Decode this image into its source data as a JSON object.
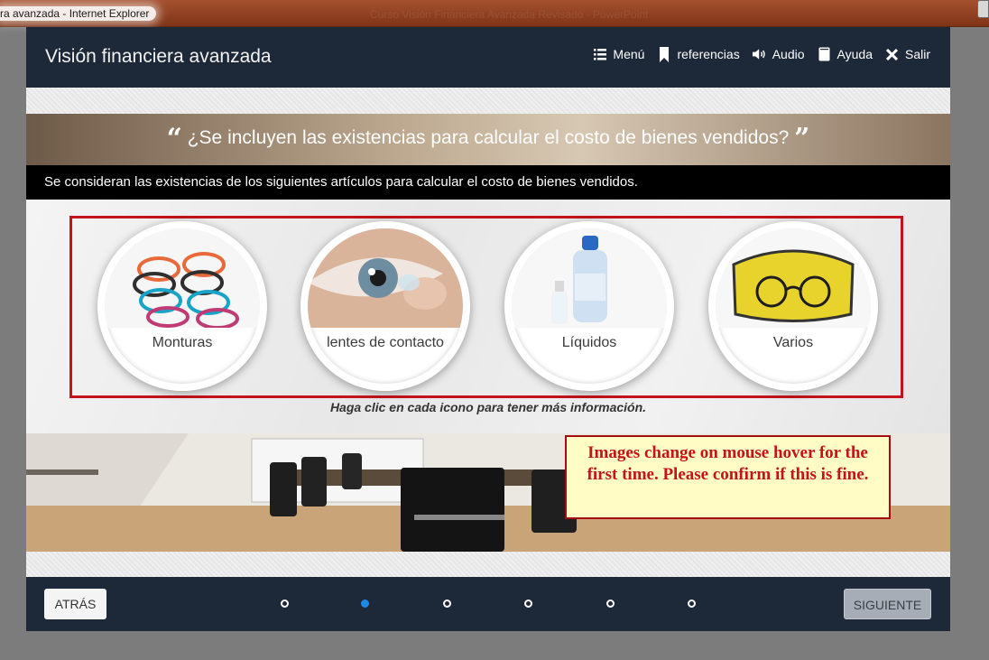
{
  "window": {
    "title": "ra avanzada - Internet Explorer",
    "ghost_title": "Curso Visión Financiera Avanzada Revisado - PowerPoint"
  },
  "app": {
    "title": "Visión financiera avanzada",
    "nav": [
      {
        "label": "Menú",
        "icon": "menu-icon"
      },
      {
        "label": "referencias",
        "icon": "bookmark-icon"
      },
      {
        "label": "Audio",
        "icon": "speaker-icon"
      },
      {
        "label": "Ayuda",
        "icon": "help-icon"
      },
      {
        "label": "Salir",
        "icon": "close-icon"
      }
    ]
  },
  "slide": {
    "question_open": "“",
    "question": "¿Se incluyen las existencias para calcular el costo de bienes vendidos?",
    "question_close": "”",
    "statement": "Se consideran las existencias de los siguientes artículos para calcular el costo de bienes vendidos.",
    "icons": [
      {
        "label": "Monturas"
      },
      {
        "label": "lentes de contacto"
      },
      {
        "label": "Líquidos"
      },
      {
        "label": "Varios"
      }
    ],
    "instruction": "Haga clic en cada icono para tener más información."
  },
  "review_note": "Images change on mouse hover for the first time. Please confirm if this is fine.",
  "footer": {
    "back_label": "ATRÁS",
    "next_label": "SIGUIENTE",
    "pages_total": 6,
    "current_page": 2
  },
  "colors": {
    "header_bg": "#1d2838",
    "highlight_border": "#c4131b",
    "active_dot": "#1e88e5",
    "note_bg": "#fffcc6"
  }
}
